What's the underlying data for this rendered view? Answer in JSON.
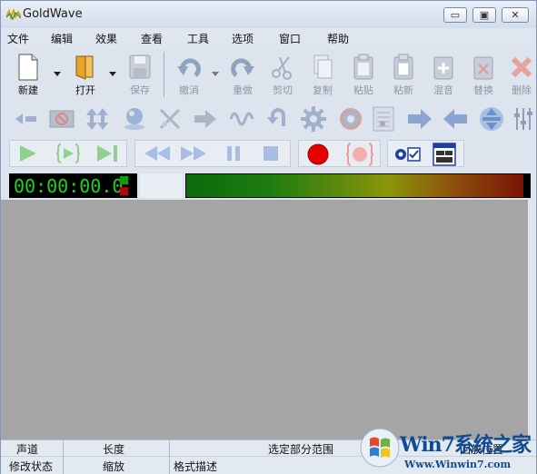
{
  "window": {
    "title": "GoldWave",
    "controls": {
      "minimize": "▭",
      "restore": "▣",
      "close": "✕"
    }
  },
  "menu": [
    "文件",
    "编辑",
    "效果",
    "查看",
    "工具",
    "选项",
    "窗口",
    "帮助"
  ],
  "toolbar": {
    "new": "新建",
    "open": "打开",
    "save": "保存",
    "undo": "撤消",
    "redo": "重做",
    "cut": "剪切",
    "copy": "复制",
    "paste": "粘贴",
    "paste_new": "粘新",
    "mix": "混音",
    "replace": "替换",
    "delete": "删除"
  },
  "effects_icons": [
    "volume-left-icon",
    "cancel-icon",
    "updown-arrows-icon",
    "sphere-icon",
    "trim-icon",
    "arrow-right-gray-icon",
    "wave-icon",
    "loop-icon",
    "gear-icon",
    "spectrum-icon",
    "notes-icon",
    "arrow-right-blue-icon",
    "arrow-left-blue-icon",
    "arrow-both-icon",
    "equalizer-icon"
  ],
  "timer": {
    "display": "00:00:00.0"
  },
  "status": {
    "row1": {
      "channel": "声道",
      "length": "长度",
      "selection_range": "选定部分范围",
      "playback_position": "回放位置"
    },
    "row2": {
      "modified_state": "修改状态",
      "zoom": "缩放",
      "format": "格式描述"
    }
  },
  "watermark": {
    "brand": "Win7系统之家",
    "url": "Www.Winwin7.com"
  },
  "colors": {
    "accent": "#114a92",
    "timer_text": "#1fd21f",
    "record_red": "#e60000",
    "workspace": "#a5a5a5"
  }
}
